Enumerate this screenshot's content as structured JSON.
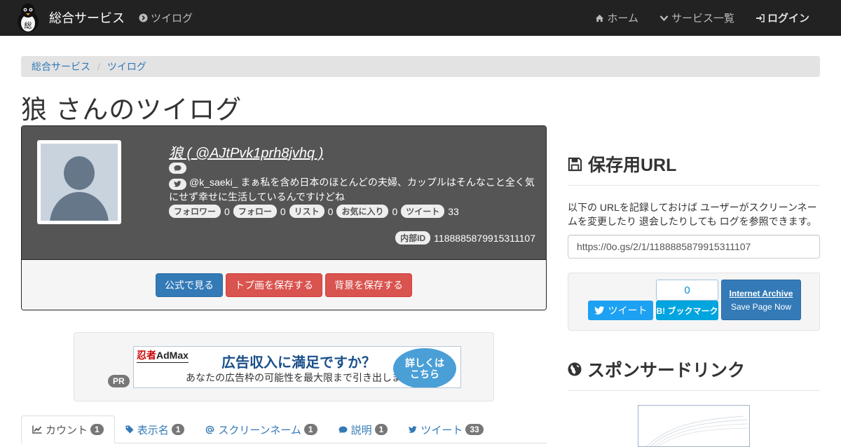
{
  "navbar": {
    "brand": "総合サービス",
    "left_link": "ツイログ",
    "home": "ホーム",
    "services": "サービス一覧",
    "login": "ログイン"
  },
  "breadcrumb": {
    "root": "総合サービス",
    "current": "ツイログ"
  },
  "page_title": "狼 さんのツイログ",
  "profile": {
    "name": "狼 ( @AJtPvk1prh8jvhq )",
    "description": "@k_saeki_ まぁ私を含め日本のほとんどの夫婦、カップルはそんなこと全く気にせず幸せに生活しているんですけどね",
    "stats": [
      {
        "label": "フォロワー",
        "value": "0"
      },
      {
        "label": "フォロー",
        "value": "0"
      },
      {
        "label": "リスト",
        "value": "0"
      },
      {
        "label": "お気に入り",
        "value": "0"
      },
      {
        "label": "ツイート",
        "value": "33"
      }
    ],
    "internal_id_label": "内部ID",
    "internal_id": "1188885879915311107",
    "buttons": {
      "official": "公式で見る",
      "save_icon": "トプ画を保存する",
      "save_bg": "背景を保存する"
    }
  },
  "ad": {
    "pr": "PR",
    "brand_prefix": "忍者",
    "brand_main": "AdMax",
    "headline": "広告収入に満足ですか？",
    "sub": "あなたの広告枠の可能性を最大限まで引き出します",
    "cta_line1": "詳しくは",
    "cta_line2": "こちら"
  },
  "tabs": [
    {
      "label": "カウント",
      "count": "1",
      "icon": "line-chart-icon"
    },
    {
      "label": "表示名",
      "count": "1",
      "icon": "tag-icon"
    },
    {
      "label": "スクリーンネーム",
      "count": "1",
      "icon": "at-icon"
    },
    {
      "label": "説明",
      "count": "1",
      "icon": "comment-icon"
    },
    {
      "label": "ツイート",
      "count": "33",
      "icon": "twitter-icon"
    }
  ],
  "save_section": {
    "title": "保存用URL",
    "description": "以下の URLを記録しておけば ユーザーがスクリーンネームを変更したり 退会したりしても ログを参照できます。",
    "url": "https://0o.gs/2/1/1188885879915311107",
    "tweet": "ツイート",
    "hatena_count": "0",
    "hatena_label": "B! ブックマーク",
    "ia_title": "Internet Archive",
    "ia_sub": "Save Page Now"
  },
  "sponsor_section": {
    "title": "スポンサードリンク"
  },
  "colors": {
    "navbar": "#222222",
    "link": "#337ab7",
    "primary": "#337ab7",
    "danger": "#d9534f",
    "twitter": "#1da1f2",
    "hatena": "#00a4de"
  }
}
